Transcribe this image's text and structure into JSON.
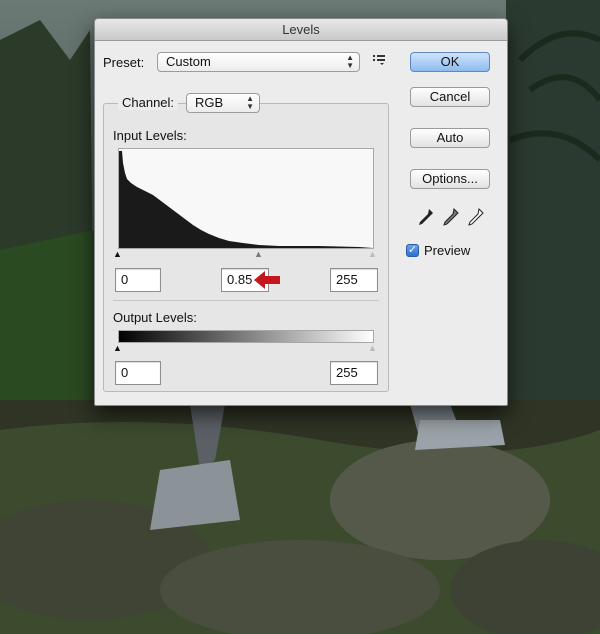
{
  "dialog": {
    "title": "Levels"
  },
  "preset": {
    "label": "Preset:",
    "value": "Custom",
    "menu_icon": "list-menu-icon"
  },
  "channel": {
    "label": "Channel:",
    "value": "RGB"
  },
  "input_levels": {
    "label": "Input Levels:",
    "black": "0",
    "gamma": "0.85",
    "white": "255"
  },
  "output_levels": {
    "label": "Output Levels:",
    "black": "0",
    "white": "255"
  },
  "buttons": {
    "ok": "OK",
    "cancel": "Cancel",
    "auto": "Auto",
    "options": "Options..."
  },
  "preview": {
    "label": "Preview",
    "checked": true
  },
  "colors": {
    "accent": "#8ebcef",
    "arrow": "#c4161c"
  }
}
